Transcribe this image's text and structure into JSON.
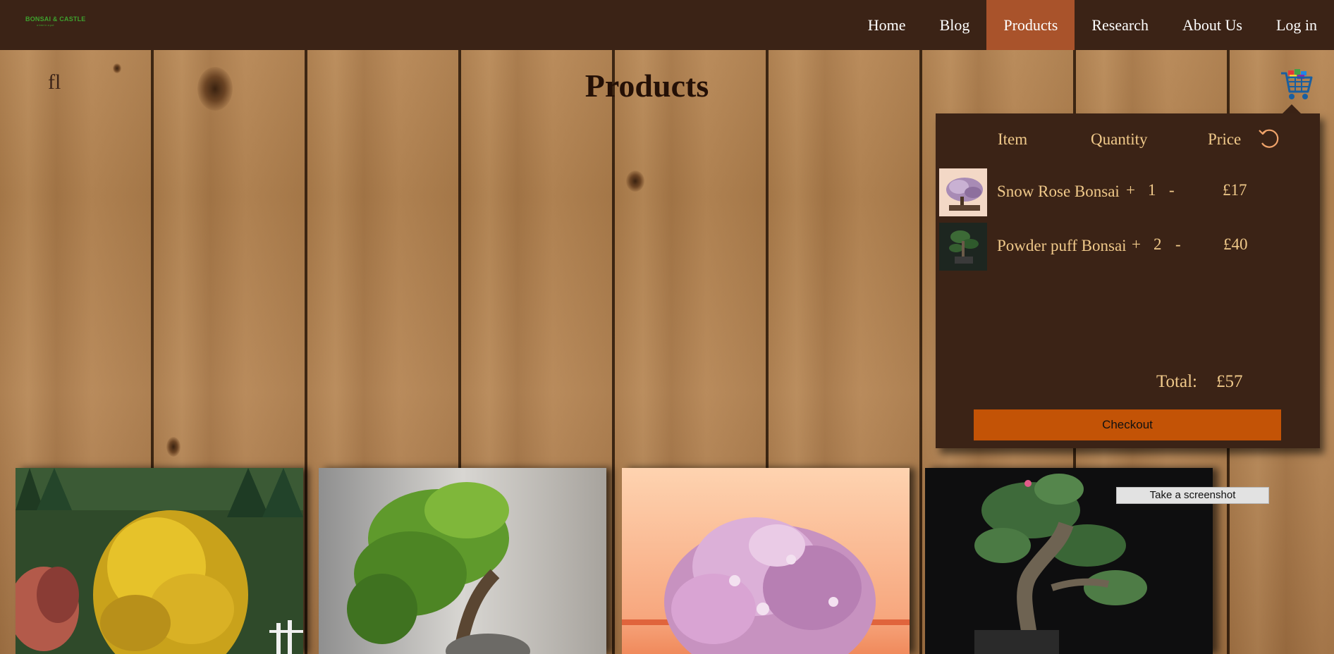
{
  "brand": {
    "logo_text": "BONSAI & CASTLE",
    "logo_sub": "a tree in a pot"
  },
  "nav": {
    "items": [
      {
        "label": "Home",
        "active": false
      },
      {
        "label": "Blog",
        "active": false
      },
      {
        "label": "Products",
        "active": true
      },
      {
        "label": "Research",
        "active": false
      },
      {
        "label": "About Us",
        "active": false
      },
      {
        "label": "Log in",
        "active": false
      }
    ],
    "active_color": "#a9532b",
    "bar_color": "#3b2316"
  },
  "page": {
    "glyph": "fl",
    "title": "Products"
  },
  "cart": {
    "headers": {
      "item": "Item",
      "quantity": "Quantity",
      "price": "Price"
    },
    "rows": [
      {
        "name": "Snow Rose Bonsai",
        "plus": "+",
        "qty": "1",
        "minus": "-",
        "price": "£17",
        "thumb": "snow-rose-bonsai"
      },
      {
        "name": "Powder puff Bonsai",
        "plus": "+",
        "qty": "2",
        "minus": "-",
        "price": "£40",
        "thumb": "powder-puff-bonsai"
      }
    ],
    "total_label": "Total:",
    "total_value": "£57",
    "checkout_label": "Checkout",
    "checkout_color": "#c35306",
    "text_color": "#f0c98a"
  },
  "products": [
    {
      "image": "autumn-maple-tree"
    },
    {
      "image": "juniper-bonsai-grey"
    },
    {
      "image": "pink-azalea-bonsai"
    },
    {
      "image": "bonsai-dark-background"
    }
  ],
  "tooltip": {
    "label": "Take a screenshot"
  }
}
